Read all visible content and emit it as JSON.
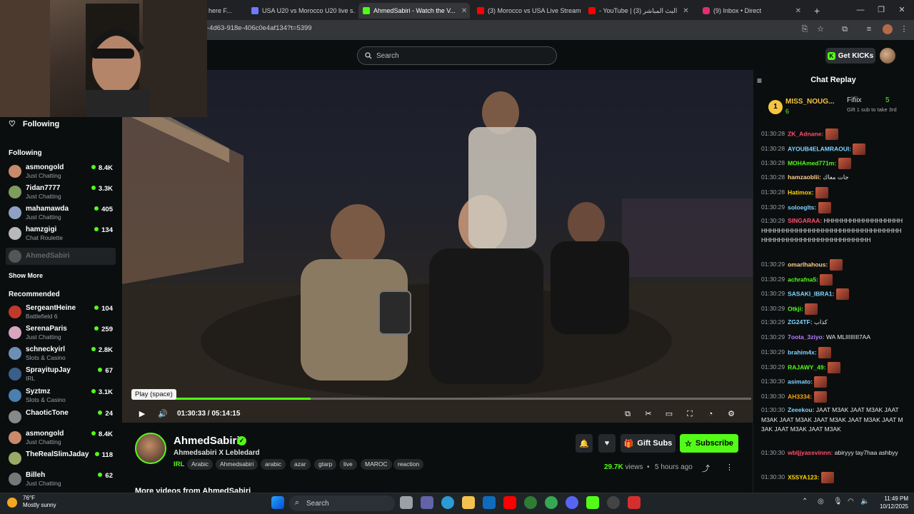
{
  "browser": {
    "tabs": [
      {
        "label": "here F...",
        "color": "#5f6368"
      },
      {
        "label": "USA U20 vs Morocco U20 live s...",
        "color": "#6c7bff"
      },
      {
        "label": "AhmedSabiri - Watch the V...",
        "color": "#53fc18"
      },
      {
        "label": "(3) Morocco vs USA Live Stream...",
        "color": "#ff0000"
      },
      {
        "label": "- YouTube | البث المباشر (3)",
        "color": "#ff0000"
      },
      {
        "label": "(9) Inbox • Direct",
        "color": "#e1306c"
      }
    ],
    "new_tab": "+",
    "url": "-4d63-918e-406c0e4af134?t=5399"
  },
  "header": {
    "search_placeholder": "Search",
    "get_kicks": "Get KICKs"
  },
  "sidebar": {
    "following_title": "Following",
    "following_header": "Following",
    "following": [
      {
        "name": "asmongold",
        "category": "Just Chatting",
        "viewers": "8.4K",
        "color": "#c98a6a"
      },
      {
        "name": "7idan7777",
        "category": "Just Chatting",
        "viewers": "3.3K",
        "color": "#7f9c5f"
      },
      {
        "name": "mahamawda",
        "category": "Just Chatting",
        "viewers": "405",
        "color": "#8fa0c4"
      },
      {
        "name": "hamzgigi",
        "category": "Chat Roulette",
        "viewers": "134",
        "color": "#b9b9b9"
      }
    ],
    "offline_item": "AhmedSabiri",
    "show_more": "Show More",
    "recommended_header": "Recommended",
    "recommended": [
      {
        "name": "SergeantHeine",
        "category": "Battlefield 6",
        "viewers": "104",
        "color": "#c0392b"
      },
      {
        "name": "SerenaParis",
        "category": "Just Chatting",
        "viewers": "259",
        "color": "#d5a6bd"
      },
      {
        "name": "schneckyirl",
        "category": "Slots & Casino",
        "viewers": "2.8K",
        "color": "#6e8fb5"
      },
      {
        "name": "SprayitupJay",
        "category": "IRL",
        "viewers": "67",
        "color": "#3a5f8a"
      },
      {
        "name": "Syztmz",
        "category": "Slots & Casino",
        "viewers": "3.1K",
        "color": "#4a7fb0"
      },
      {
        "name": "ChaoticTone",
        "category": "",
        "viewers": "24",
        "color": "#888"
      },
      {
        "name": "asmongold",
        "category": "Just Chatting",
        "viewers": "8.4K",
        "color": "#c98a6a"
      },
      {
        "name": "TheRealSlimJaday",
        "category": "",
        "viewers": "118",
        "color": "#9a6"
      },
      {
        "name": "Billeh",
        "category": "Just Chatting",
        "viewers": "62",
        "color": "#777"
      }
    ]
  },
  "player": {
    "tooltip": "Play (space)",
    "time": "01:30:33 / 05:14:15",
    "progress": 0.288
  },
  "stream": {
    "streamer": "AhmedSabiri",
    "title": "Ahmedsabiri X Lebledard",
    "category": "IRL",
    "tags": [
      "Arabic",
      "Ahmedsabiri",
      "arabic",
      "azar",
      "gtarp",
      "live",
      "MAROC",
      "reaction"
    ],
    "gift_subs": "Gift Subs",
    "subscribe": "Subscribe",
    "views_count": "29.7K",
    "views_label": "views",
    "ago": "5 hours ago",
    "more_videos": "More videos from AhmedSabiri"
  },
  "chat": {
    "title": "Chat Replay",
    "top_gifters": [
      {
        "rank": "1",
        "name": "MISS_NOUG...",
        "count": "6"
      },
      {
        "name": "Fifiix",
        "count": "5",
        "note": "Gift 1 sub to take 3rd"
      }
    ],
    "messages": [
      {
        "ts": "01:30:28",
        "user": "ZK_Adnane:",
        "color": "#ff4f6d",
        "text": ""
      },
      {
        "ts": "01:30:28",
        "user": "AYOUB4ELAMRAOUI:",
        "color": "#7fd6ff",
        "text": ""
      },
      {
        "ts": "01:30:28",
        "user": "MOHAmed771m:",
        "color": "#53fc18",
        "text": ""
      },
      {
        "ts": "01:30:28",
        "user": "hamzaoblii:",
        "color": "#ffd08a",
        "text": "جات معاك"
      },
      {
        "ts": "01:30:28",
        "user": "Hatimox:",
        "color": "#ffd700",
        "text": ""
      },
      {
        "ts": "01:30:29",
        "user": "soloeglts:",
        "color": "#7fd6ff",
        "text": ""
      },
      {
        "ts": "01:30:29",
        "user": "SINGARAA:",
        "color": "#ff4f6d",
        "text": "HHHHHHHHHHHHHHHHHHHHHHHHHHHHHHHHHHHHHHHHHHHHHHHHHHHHHHHHHHHHHHHHHHHHHHHHHHH"
      },
      {
        "ts": "01:30:29",
        "user": "omarlhahous:",
        "color": "#ffd08a",
        "text": ""
      },
      {
        "ts": "01:30:29",
        "user": "achrafna5:",
        "color": "#53fc18",
        "text": ""
      },
      {
        "ts": "01:30:29",
        "user": "SASAKI_IBRA1:",
        "color": "#7fd6ff",
        "text": ""
      },
      {
        "ts": "01:30:29",
        "user": "Otkji:",
        "color": "#53fc18",
        "text": ""
      },
      {
        "ts": "01:30:29",
        "user": "ZG24TF:",
        "color": "#7fd6ff",
        "text": "كذاب"
      },
      {
        "ts": "01:30:29",
        "user": "7oota_3ziyo:",
        "color": "#b57fff",
        "text": "WA MLIIIIIIII7AA"
      },
      {
        "ts": "01:30:29",
        "user": "brahim4x:",
        "color": "#7fd6ff",
        "text": ""
      },
      {
        "ts": "01:30:29",
        "user": "RAJAWY_49:",
        "color": "#53fc18",
        "text": ""
      },
      {
        "ts": "01:30:30",
        "user": "asimato:",
        "color": "#7fd6ff",
        "text": ""
      },
      {
        "ts": "01:30:30",
        "user": "AH3334:",
        "color": "#ffa500",
        "text": ""
      },
      {
        "ts": "01:30:30",
        "user": "Zeeekou:",
        "color": "#7fd6ff",
        "text": "JAAT M3AK JAAT M3AK JAAT M3AK JAAT M3AK JAAT M3AK JAAT M3AK JAAT M3AK JAAT M3AK JAAT M3AK"
      },
      {
        "ts": "01:30:30",
        "user": "wbljjyassvinnn:",
        "color": "#ff4f6d",
        "text": "abiryyy tay7haa ashbyy"
      },
      {
        "ts": "01:30:30",
        "user": "X5SYA123:",
        "color": "#ffd700",
        "text": ""
      }
    ]
  },
  "taskbar": {
    "weather_temp": "76°F",
    "weather_desc": "Mostly sunny",
    "search": "Search",
    "time": "11:49 PM",
    "date": "10/12/2025"
  }
}
